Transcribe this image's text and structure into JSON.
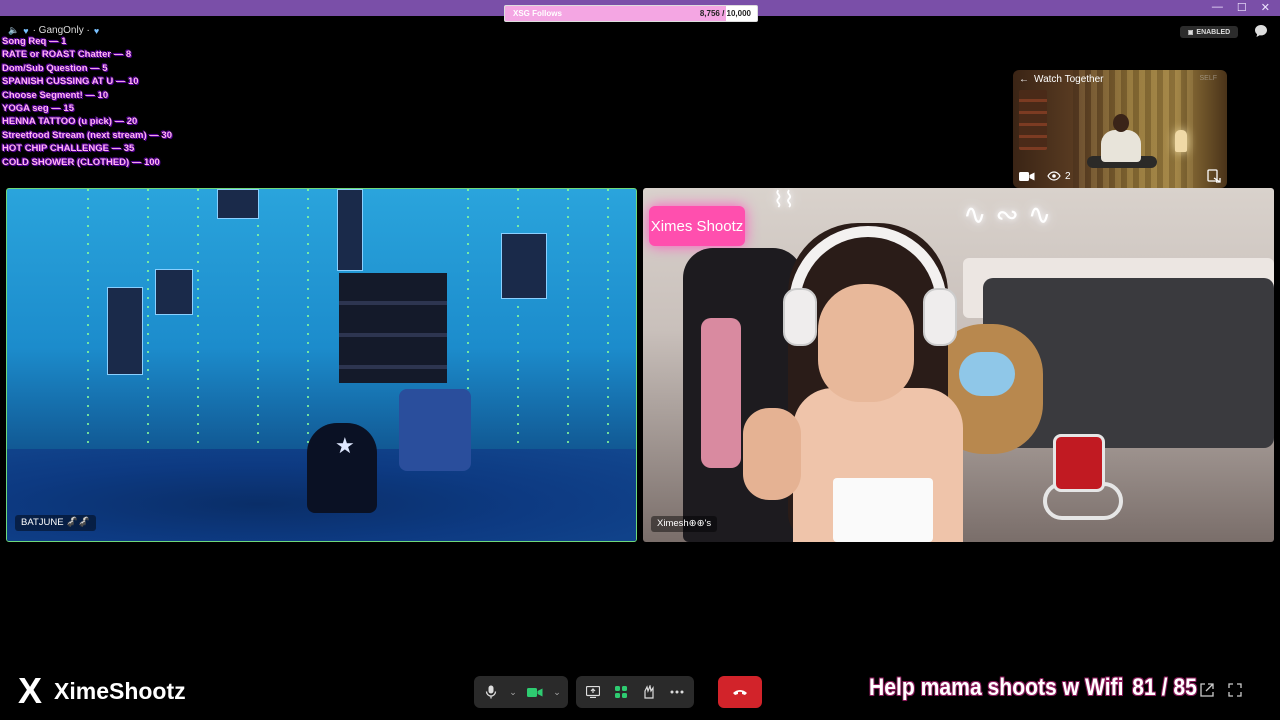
{
  "window": {
    "controls": [
      "—",
      "☐",
      "✕"
    ]
  },
  "follow_goal": {
    "label": "XSG Follows",
    "current": "8,756",
    "target": "10,000",
    "separator": " / ",
    "progress": 0.8756
  },
  "gang": {
    "text": "· GangOnly ·"
  },
  "menu": [
    "Song Req — 1",
    "RATE or ROAST Chatter — 8",
    "Dom/Sub Question — 5",
    "SPANISH CUSSING AT U — 10",
    "Choose Segment! — 10",
    "YOGA seg — 15",
    "HENNA TATTOO (u pick) — 20",
    "Streetfood Stream (next stream) — 30",
    "HOT CHIP CHALLENGE — 35",
    "COLD SHOWER (CLOTHED) — 100"
  ],
  "status_badge": {
    "label": "ENABLED"
  },
  "watch_together": {
    "title": "Watch Together",
    "self_label": "SELF",
    "viewer_count": "2"
  },
  "tiles": {
    "left": {
      "name": "BATJUNE 🦨🦨"
    },
    "right": {
      "name": "Ximesh⊕⊕'s",
      "neon_sign": "Ximes Shootz"
    }
  },
  "brand": {
    "logo": "X",
    "name": "XimeShootz"
  },
  "controls": {
    "icons": [
      "microphone-icon",
      "camera-icon",
      "screen-share-icon",
      "activities-icon",
      "effects-icon",
      "more-icon",
      "hang-up-icon"
    ],
    "hangup_color": "#d2232a"
  },
  "goal": {
    "text": "Help mama shoots w Wifi",
    "count": "81 / 85"
  },
  "colors": {
    "titlebar": "#7a4fa8",
    "menu_text": "#ffb3ef",
    "follow_fill": "#f4a6e3",
    "tile_border": "#6fd97a"
  }
}
